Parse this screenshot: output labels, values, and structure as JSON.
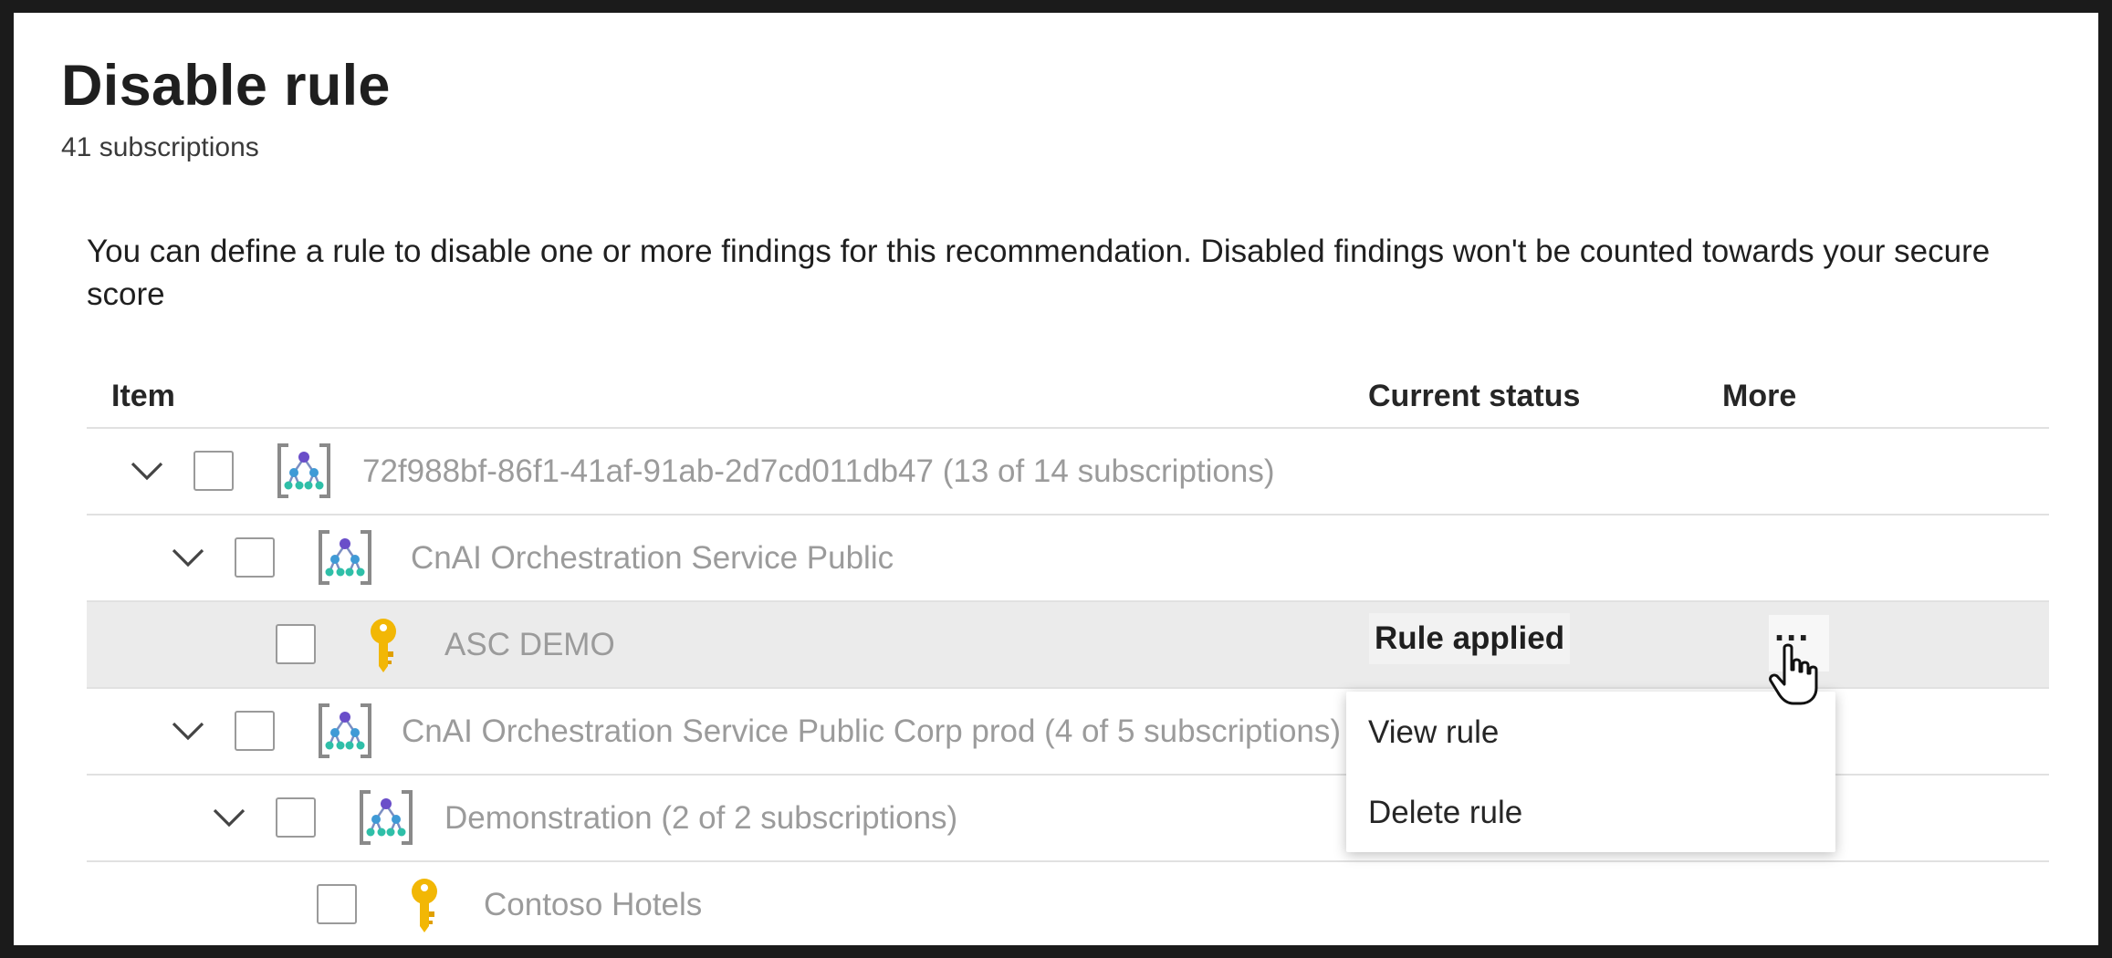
{
  "header": {
    "title": "Disable rule",
    "subtitle": "41 subscriptions"
  },
  "description": "You can define a rule to disable one or more findings for this recommendation. Disabled findings won't be counted towards your secure score",
  "columns": {
    "item": "Item",
    "status": "Current status",
    "more": "More"
  },
  "rows": [
    {
      "label": "72f988bf-86f1-41af-91ab-2d7cd011db47 (13 of 14 subscriptions)",
      "icon": "management-group-icon",
      "expandable": true,
      "status": ""
    },
    {
      "label": "CnAI Orchestration Service Public",
      "icon": "management-group-icon",
      "expandable": true,
      "status": ""
    },
    {
      "label": "ASC DEMO",
      "icon": "key-icon",
      "expandable": false,
      "status": "Rule applied"
    },
    {
      "label": "CnAI Orchestration Service Public Corp prod (4 of 5 subscriptions)",
      "icon": "management-group-icon",
      "expandable": true,
      "status": ""
    },
    {
      "label": "Demonstration (2 of 2 subscriptions)",
      "icon": "management-group-icon",
      "expandable": true,
      "status": ""
    },
    {
      "label": "Contoso Hotels",
      "icon": "key-icon",
      "expandable": false,
      "status": ""
    }
  ],
  "more_button": {
    "label": "..."
  },
  "context_menu": {
    "items": [
      "View rule",
      "Delete rule"
    ]
  },
  "colors": {
    "text_primary": "#1f1f1f",
    "text_disabled": "#9b9b9b",
    "selected_row": "#ebebeb",
    "key_yellow": "#f2b705",
    "group_blue": "#3f9ad6"
  }
}
